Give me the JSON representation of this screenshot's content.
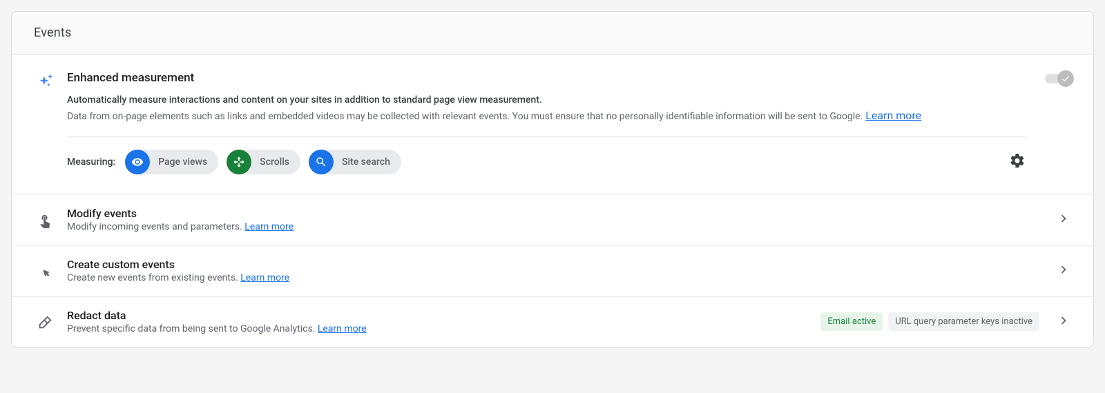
{
  "card": {
    "title": "Events"
  },
  "enhanced": {
    "title": "Enhanced measurement",
    "desc_bold": "Automatically measure interactions and content on your sites in addition to standard page view measurement.",
    "desc_sub": "Data from on-page elements such as links and embedded videos may be collected with relevant events. You must ensure that no personally identifiable information will be sent to Google.",
    "learn_more": "Learn more",
    "measuring_label": "Measuring:",
    "chips": {
      "page_views": "Page views",
      "scrolls": "Scrolls",
      "site_search": "Site search"
    }
  },
  "rows": {
    "modify": {
      "title": "Modify events",
      "desc": "Modify incoming events and parameters. ",
      "learn_more": "Learn more"
    },
    "create": {
      "title": "Create custom events",
      "desc": "Create new events from existing events. ",
      "learn_more": "Learn more"
    },
    "redact": {
      "title": "Redact data",
      "desc": "Prevent specific data from being sent to Google Analytics. ",
      "learn_more": "Learn more",
      "tags": {
        "email": "Email active",
        "url": "URL query parameter keys inactive"
      }
    }
  }
}
